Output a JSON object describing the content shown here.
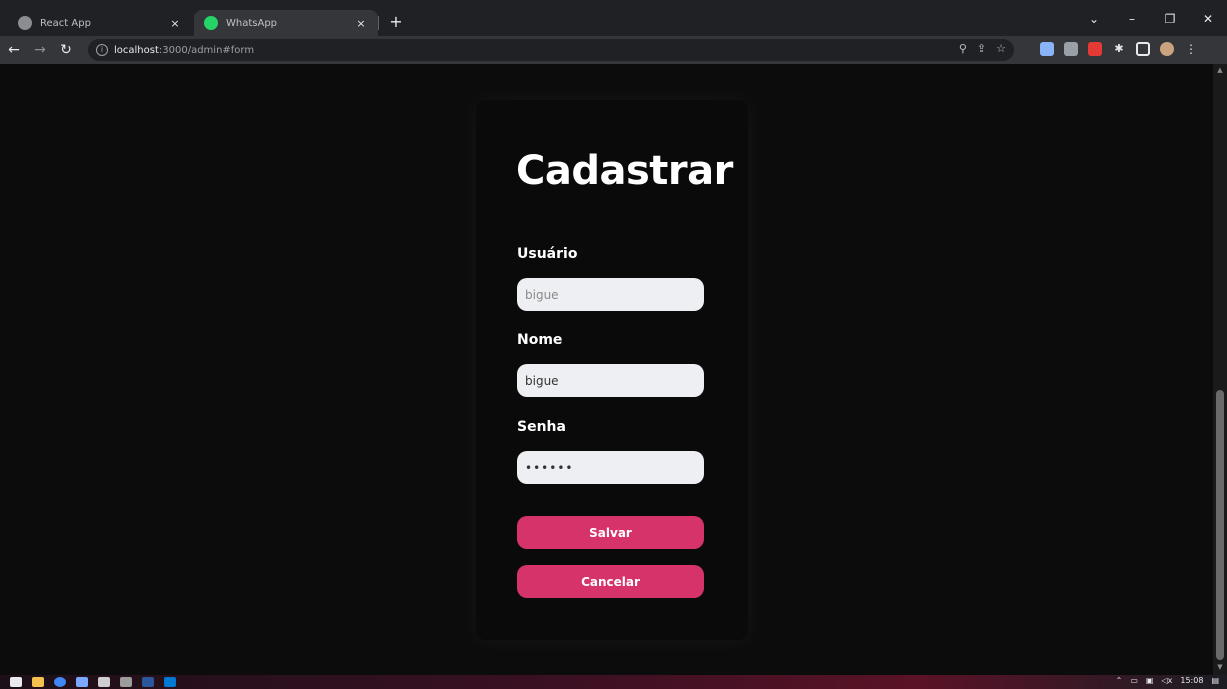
{
  "browser": {
    "tabs": [
      {
        "title": "React App",
        "active": false
      },
      {
        "title": "WhatsApp",
        "active": true
      }
    ],
    "new_tab_glyph": "+",
    "close_glyph": "×",
    "url_host": "localhost",
    "url_path": ":3000/admin#form",
    "window_controls": [
      "⌄",
      "–",
      "❐",
      "✕"
    ]
  },
  "form": {
    "title": "Cadastrar",
    "usuario_label": "Usuário",
    "usuario_placeholder": "bigue",
    "nome_label": "Nome",
    "nome_value": "bigue",
    "senha_label": "Senha",
    "senha_value": "••••••",
    "save_label": "Salvar",
    "cancel_label": "Cancelar"
  },
  "taskbar": {
    "time": "15:08"
  },
  "colors": {
    "accent": "#d7336b",
    "page_bg": "#0c0c0d",
    "input_bg": "#eeeff3"
  }
}
